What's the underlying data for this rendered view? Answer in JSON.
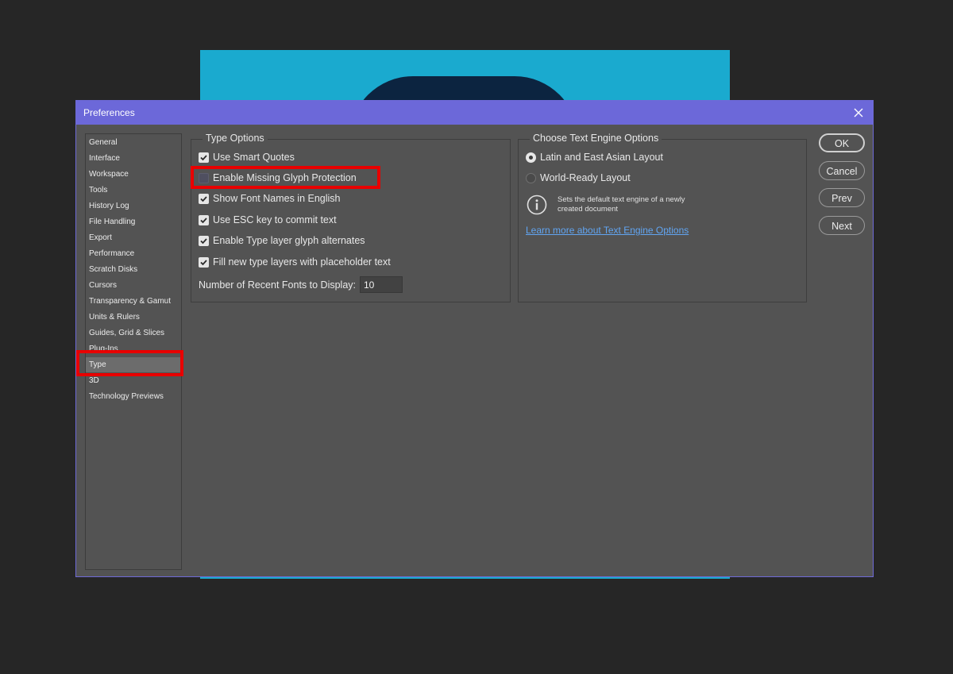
{
  "dialog": {
    "title": "Preferences"
  },
  "sidebar": {
    "items": [
      {
        "label": "General",
        "selected": false
      },
      {
        "label": "Interface",
        "selected": false
      },
      {
        "label": "Workspace",
        "selected": false
      },
      {
        "label": "Tools",
        "selected": false
      },
      {
        "label": "History Log",
        "selected": false
      },
      {
        "label": "File Handling",
        "selected": false
      },
      {
        "label": "Export",
        "selected": false
      },
      {
        "label": "Performance",
        "selected": false
      },
      {
        "label": "Scratch Disks",
        "selected": false
      },
      {
        "label": "Cursors",
        "selected": false
      },
      {
        "label": "Transparency & Gamut",
        "selected": false
      },
      {
        "label": "Units & Rulers",
        "selected": false
      },
      {
        "label": "Guides, Grid & Slices",
        "selected": false
      },
      {
        "label": "Plug-Ins",
        "selected": false
      },
      {
        "label": "Type",
        "selected": true
      },
      {
        "label": "3D",
        "selected": false
      },
      {
        "label": "Technology Previews",
        "selected": false
      }
    ]
  },
  "type_options": {
    "legend": "Type Options",
    "options": [
      {
        "label": "Use Smart Quotes",
        "checked": true
      },
      {
        "label": "Enable Missing Glyph Protection",
        "checked": false
      },
      {
        "label": "Show Font Names in English",
        "checked": true
      },
      {
        "label": "Use ESC key to commit text",
        "checked": true
      },
      {
        "label": "Enable Type layer glyph alternates",
        "checked": true
      },
      {
        "label": "Fill new type layers with placeholder text",
        "checked": true
      }
    ],
    "recent_fonts_label": "Number of Recent Fonts to Display:",
    "recent_fonts_value": "10"
  },
  "text_engine": {
    "legend": "Choose Text Engine Options",
    "options": [
      {
        "label": "Latin and East Asian Layout",
        "selected": true
      },
      {
        "label": "World-Ready Layout",
        "selected": false
      }
    ],
    "info_text": "Sets the default text engine of a newly created document",
    "link_text": "Learn more about Text Engine Options"
  },
  "buttons": {
    "ok": "OK",
    "cancel": "Cancel",
    "prev": "Prev",
    "next": "Next"
  },
  "colors": {
    "titlebar": "#6c68d9",
    "dialog_bg": "#535353",
    "canvas_doc": "#1aaacf",
    "highlight": "#e80000",
    "link": "#61a5f2"
  }
}
